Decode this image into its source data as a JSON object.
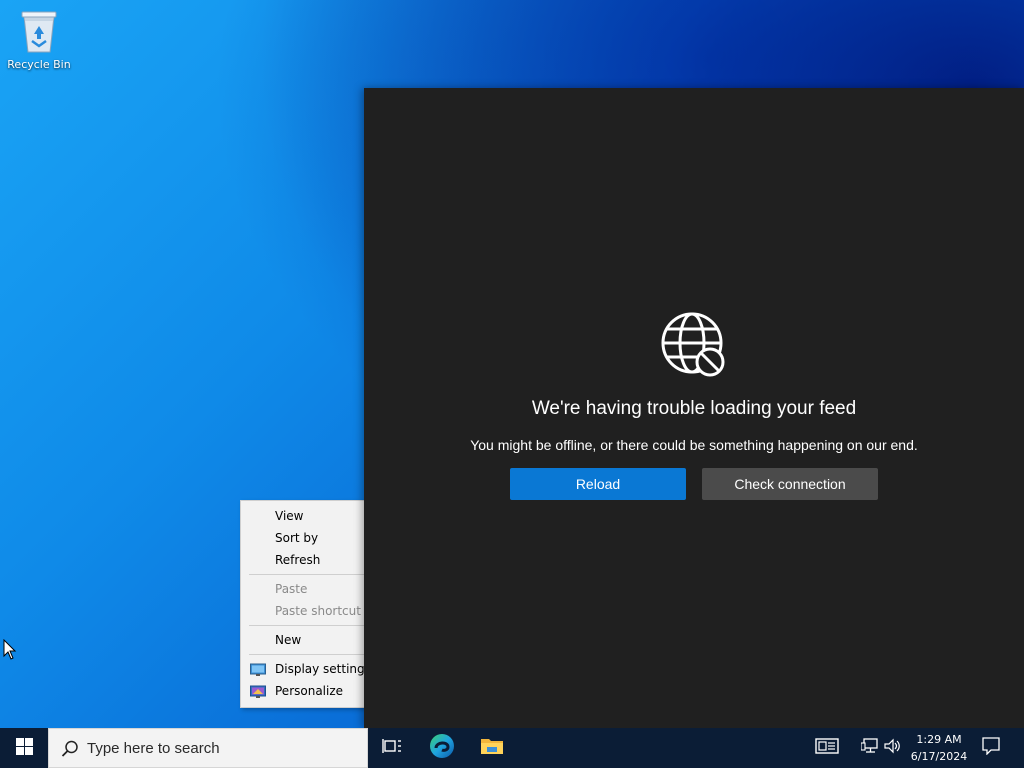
{
  "desktop": {
    "icons": [
      {
        "label": "Recycle Bin",
        "icon": "recycle-bin-icon"
      }
    ]
  },
  "feed": {
    "title": "We're having trouble loading your feed",
    "subtitle": "You might be offline, or there could be something happening on our end.",
    "reload_label": "Reload",
    "check_connection_label": "Check connection",
    "icon": "globe-blocked-icon"
  },
  "context_menu": {
    "items": [
      {
        "label": "View",
        "enabled": true
      },
      {
        "label": "Sort by",
        "enabled": true
      },
      {
        "label": "Refresh",
        "enabled": true
      },
      {
        "label": "Paste",
        "enabled": false
      },
      {
        "label": "Paste shortcut",
        "enabled": false
      },
      {
        "label": "New",
        "enabled": true
      },
      {
        "label": "Display settings",
        "enabled": true,
        "icon": "display-settings-icon"
      },
      {
        "label": "Personalize",
        "enabled": true,
        "icon": "personalize-icon"
      }
    ]
  },
  "taskbar": {
    "search_placeholder": "Type here to search",
    "pinned": [
      "task-view-icon",
      "edge-icon",
      "file-explorer-icon"
    ],
    "tray": [
      "news-icon",
      "network-icon",
      "volume-icon",
      "notifications-icon"
    ],
    "time": "1:29 AM",
    "date": "6/17/2024"
  },
  "colors": {
    "accent": "#0a78d4",
    "panel_bg": "#202020",
    "taskbar_bg": "#0b1d36"
  }
}
